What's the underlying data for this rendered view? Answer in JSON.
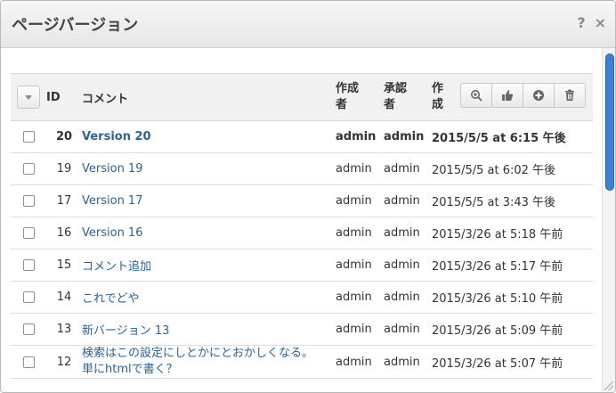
{
  "dialog": {
    "title": "ページバージョン",
    "help_label": "?",
    "close_label": "×"
  },
  "table": {
    "headers": {
      "id": "ID",
      "comment": "コメント",
      "author_line1": "作成",
      "author_line2": "者",
      "approver_line1": "承認",
      "approver_line2": "者",
      "created_line1": "作",
      "created_line2": "成"
    },
    "toolbar_icons": [
      "zoom-icon",
      "approve-thumb-icon",
      "add-icon",
      "trash-icon"
    ],
    "rows": [
      {
        "id": "20",
        "comment": "Version 20",
        "author": "admin",
        "approver": "admin",
        "date": "2015/5/5 at 6:15 午後",
        "bold": true
      },
      {
        "id": "19",
        "comment": "Version 19",
        "author": "admin",
        "approver": "admin",
        "date": "2015/5/5 at 6:02 午後"
      },
      {
        "id": "17",
        "comment": "Version 17",
        "author": "admin",
        "approver": "admin",
        "date": "2015/5/5 at 3:43 午後"
      },
      {
        "id": "16",
        "comment": "Version 16",
        "author": "admin",
        "approver": "admin",
        "date": "2015/3/26 at 5:18 午前"
      },
      {
        "id": "15",
        "comment": "コメント追加",
        "author": "admin",
        "approver": "admin",
        "date": "2015/3/26 at 5:17 午前"
      },
      {
        "id": "14",
        "comment": "これでどや",
        "author": "admin",
        "approver": "admin",
        "date": "2015/3/26 at 5:10 午前"
      },
      {
        "id": "13",
        "comment": "新バージョン 13",
        "author": "admin",
        "approver": "admin",
        "date": "2015/3/26 at 5:09 午前"
      },
      {
        "id": "12",
        "comment_line1": "検索はこの設定にしとかにとおかしくなる。",
        "comment_line2": "単にhtmlで書く？",
        "author": "admin",
        "approver": "admin",
        "date": "2015/3/26 at 5:07 午前"
      }
    ]
  },
  "colors": {
    "link": "#2a6496",
    "scroll_thumb": "#3b7fd6"
  }
}
